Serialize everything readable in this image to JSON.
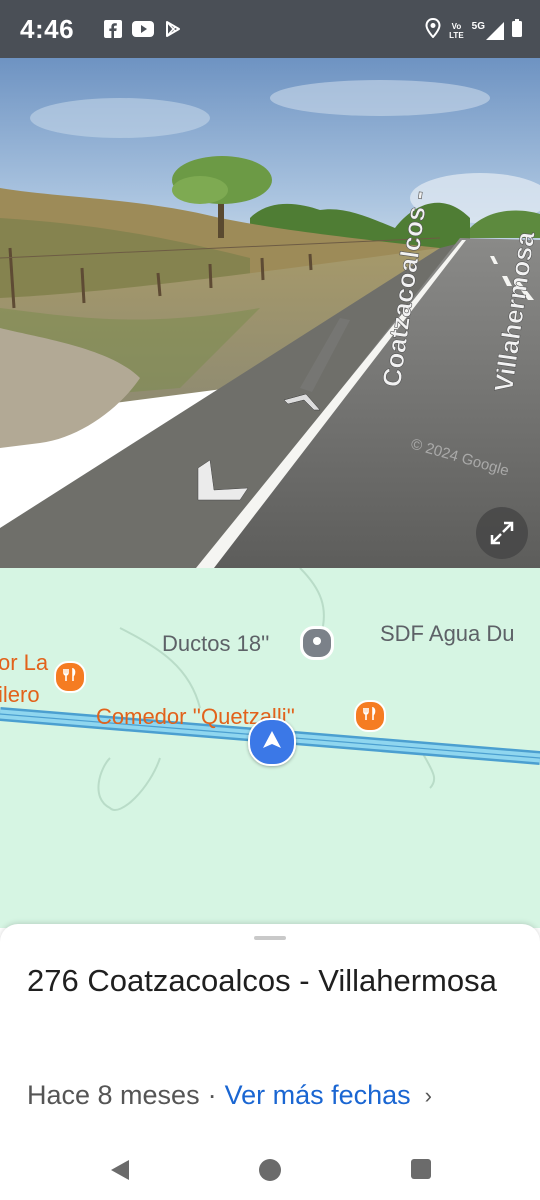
{
  "status_bar": {
    "time": "4:46",
    "left_icons": [
      "facebook-icon",
      "youtube-icon",
      "play-store-icon"
    ],
    "network_volte": "Vo\nLTE",
    "network_type": "5G",
    "right_icons": [
      "location-icon",
      "volte-icon",
      "signal-icon",
      "battery-icon"
    ]
  },
  "street_view": {
    "road_sign": "Coatzacoalcos - Villahermosa",
    "watermark": "© 2024 Google",
    "expand_icon": "expand-icon"
  },
  "map": {
    "labels": {
      "ductos": "Ductos 18''",
      "sdf": "SDF Agua Du",
      "comedor": "Comedor ''Quetzalli''",
      "left_top": "or La",
      "left_bottom": "ilero"
    },
    "colors": {
      "map_bg": "#d6f5e3",
      "road": "#6cc4e6",
      "poi_orange": "#f57c22",
      "location_blue": "#3b78e7"
    }
  },
  "sheet": {
    "title": "276 Coatzacoalcos - Villahermosa",
    "date_text": "Hace 8 meses",
    "separator": "·",
    "link_text": "Ver más fechas",
    "chevron": "›"
  },
  "nav": {
    "back": "back-icon",
    "home": "home-icon",
    "recents": "recents-icon"
  }
}
